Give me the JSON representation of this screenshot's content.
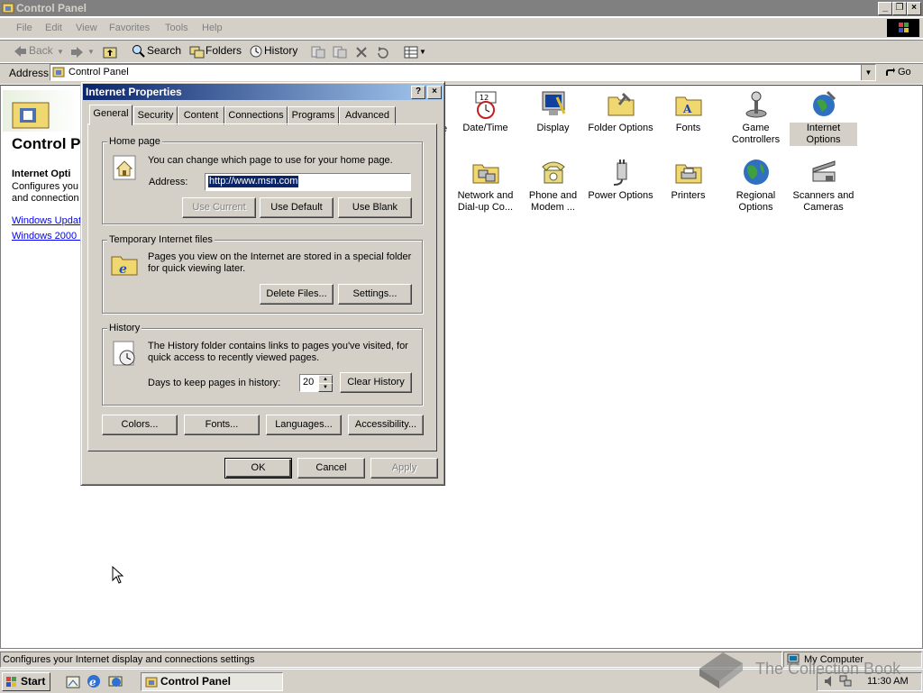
{
  "window": {
    "title": "Control Panel"
  },
  "menu": [
    "File",
    "Edit",
    "View",
    "Favorites",
    "Tools",
    "Help"
  ],
  "toolbar": {
    "back": "Back",
    "search": "Search",
    "folders": "Folders",
    "history": "History"
  },
  "address": {
    "label": "Address",
    "value": "Control Panel",
    "go": "Go"
  },
  "left_pane": {
    "title": "Control P",
    "section_title": "Internet Opti",
    "desc_line1": "Configures you",
    "desc_line2": "and connection",
    "link1": "Windows Updat",
    "link2": "Windows 2000 :"
  },
  "icons": [
    {
      "label": "Date/Time",
      "icon": "clock-icon"
    },
    {
      "label": "Display",
      "icon": "monitor-icon"
    },
    {
      "label": "Folder Options",
      "icon": "folder-options-icon"
    },
    {
      "label": "Fonts",
      "icon": "fonts-folder-icon"
    },
    {
      "label": "Game Controllers",
      "icon": "joystick-icon"
    },
    {
      "label": "Internet Options",
      "icon": "internet-globe-icon"
    },
    {
      "label": "Network and Dial-up Co...",
      "icon": "network-icon"
    },
    {
      "label": "Phone and Modem ...",
      "icon": "phone-icon"
    },
    {
      "label": "Power Options",
      "icon": "power-plug-icon"
    },
    {
      "label": "Printers",
      "icon": "printer-folder-icon"
    },
    {
      "label": "Regional Options",
      "icon": "regional-globe-icon"
    },
    {
      "label": "Scanners and Cameras",
      "icon": "scanner-icon"
    }
  ],
  "partial_icon_text": "e",
  "dialog": {
    "title": "Internet Properties",
    "help": "?",
    "close": "×",
    "tabs": [
      "General",
      "Security",
      "Content",
      "Connections",
      "Programs",
      "Advanced"
    ],
    "home": {
      "group": "Home page",
      "desc": "You can change which page to use for your home page.",
      "address_label": "Address:",
      "address_value": "http://www.msn.com",
      "use_current": "Use Current",
      "use_default": "Use Default",
      "use_blank": "Use Blank"
    },
    "temp": {
      "group": "Temporary Internet files",
      "desc1": "Pages you view on the Internet are stored in a special folder",
      "desc2": "for quick viewing later.",
      "delete": "Delete Files...",
      "settings": "Settings..."
    },
    "history": {
      "group": "History",
      "desc1": "The History folder contains links to pages you've visited, for",
      "desc2": "quick access to recently viewed pages.",
      "days_label": "Days to keep pages in history:",
      "days_value": "20",
      "clear": "Clear History"
    },
    "bottom": {
      "colors": "Colors...",
      "fonts": "Fonts...",
      "languages": "Languages...",
      "accessibility": "Accessibility..."
    },
    "ok": "OK",
    "cancel": "Cancel",
    "apply": "Apply"
  },
  "status": {
    "text": "Configures your Internet display and connections settings",
    "zone": "My Computer"
  },
  "taskbar": {
    "start": "Start",
    "task": "Control Panel",
    "clock": "11:30 AM"
  },
  "watermark": "The Collection Book"
}
